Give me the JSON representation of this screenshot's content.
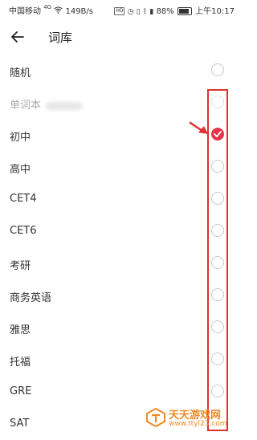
{
  "status_bar": {
    "carrier": "中国移动",
    "signal": "4G",
    "speed": "149B/s",
    "hd": "HD",
    "battery": "88%",
    "time": "上午10:17"
  },
  "header": {
    "back_icon": "arrow-left-icon",
    "title": "词库"
  },
  "list": {
    "items": [
      {
        "label": "随机",
        "selected": false
      },
      {
        "label": "单词本",
        "selected": false,
        "disabled": true
      },
      {
        "label": "初中",
        "selected": true
      },
      {
        "label": "高中",
        "selected": false
      },
      {
        "label": "CET4",
        "selected": false
      },
      {
        "label": "CET6",
        "selected": false
      },
      {
        "label": "考研",
        "selected": false
      },
      {
        "label": "商务英语",
        "selected": false
      },
      {
        "label": "雅思",
        "selected": false
      },
      {
        "label": "托福",
        "selected": false
      },
      {
        "label": "GRE",
        "selected": false
      },
      {
        "label": "SAT",
        "selected": false
      }
    ]
  },
  "colors": {
    "accent": "#e8344a",
    "annotation": "#e03131",
    "watermark": "#f08a24"
  },
  "watermark": {
    "title": "天天游戏网",
    "url": "www.ttyl23.com"
  }
}
